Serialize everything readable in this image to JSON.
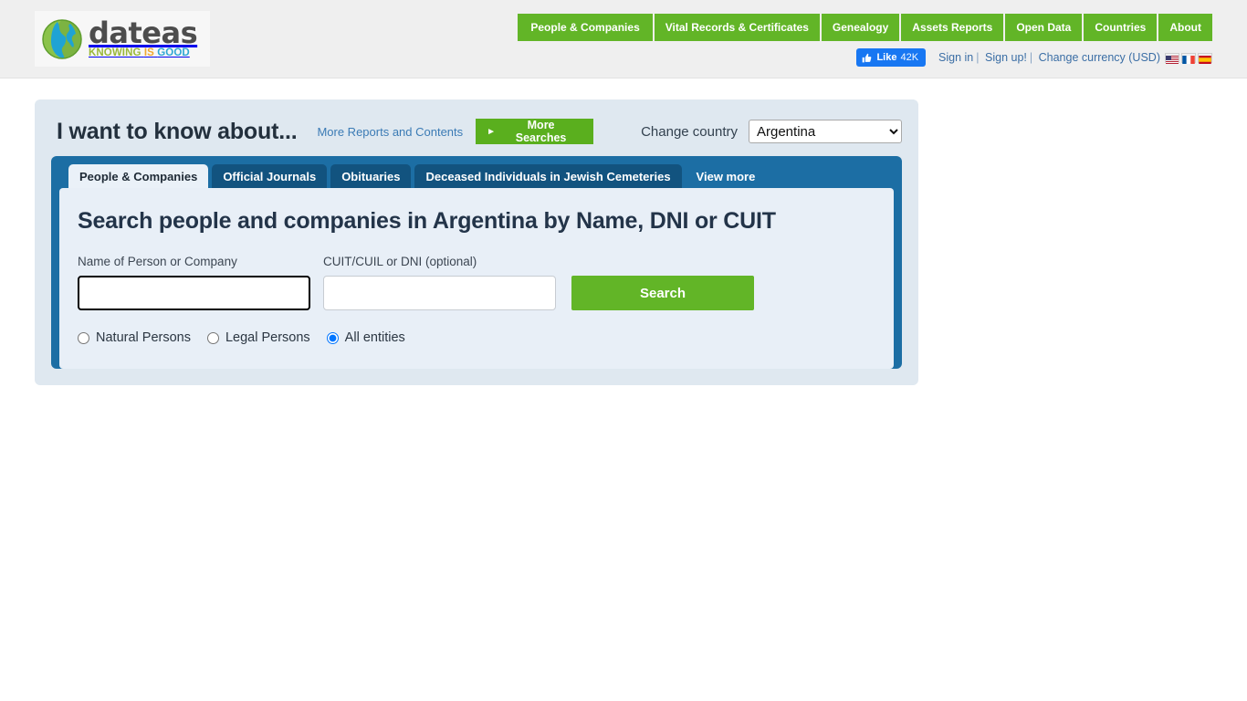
{
  "header": {
    "logo": {
      "word": "dateas",
      "tagline_parts": [
        "KNOWING",
        "IS",
        "GOOD"
      ],
      "tagline_full": "KNOWING IS GOOD",
      "globe_icon": "globe-icon"
    },
    "nav": [
      {
        "label": "People & Companies"
      },
      {
        "label": "Vital Records & Certificates"
      },
      {
        "label": "Genealogy"
      },
      {
        "label": "Assets Reports"
      },
      {
        "label": "Open Data"
      },
      {
        "label": "Countries"
      },
      {
        "label": "About"
      }
    ],
    "utility": {
      "facebook_like_label": "Like",
      "facebook_like_count": "42K",
      "sign_in": "Sign in",
      "separator_1": "|",
      "sign_up": "Sign up!",
      "separator_2": "|",
      "change_currency": "Change currency (USD)",
      "flags": [
        {
          "name": "flag-us"
        },
        {
          "name": "flag-fr"
        },
        {
          "name": "flag-es"
        }
      ]
    }
  },
  "panel": {
    "title": "I want to know about...",
    "more_reports_link": "More Reports and Contents",
    "more_searches_button": "More Searches",
    "more_searches_caret": "►",
    "change_country_label": "Change country",
    "country_selected": "Argentina",
    "country_options": [
      "Argentina"
    ],
    "tabs": [
      {
        "label": "People & Companies",
        "active": true
      },
      {
        "label": "Official Journals",
        "active": false
      },
      {
        "label": "Obituaries",
        "active": false
      },
      {
        "label": "Deceased Individuals in Jewish Cemeteries",
        "active": false
      },
      {
        "label": "View more",
        "active": false
      }
    ],
    "search": {
      "heading": "Search people and companies in Argentina by Name, DNI or CUIT",
      "name_label": "Name of Person or Company",
      "name_value": "",
      "name_placeholder": "",
      "id_label": "CUIT/CUIL or DNI (optional)",
      "id_value": "",
      "id_placeholder": "",
      "search_button": "Search",
      "entity_options": [
        {
          "label": "Natural Persons",
          "selected": false
        },
        {
          "label": "Legal Persons",
          "selected": false
        },
        {
          "label": "All entities",
          "selected": true
        }
      ]
    }
  },
  "colors": {
    "nav_green": "#62b527",
    "button_green": "#5aaf1e",
    "panel_blue": "#1c6ea4",
    "tab_dark_blue": "#12537f",
    "link_blue": "#3b7bb5",
    "facebook_blue": "#1877f2",
    "page_bg": "#ffffff",
    "header_bg": "#efefef",
    "outer_panel_bg": "#dfe8f0",
    "tab_body_bg": "#e8eff7"
  }
}
